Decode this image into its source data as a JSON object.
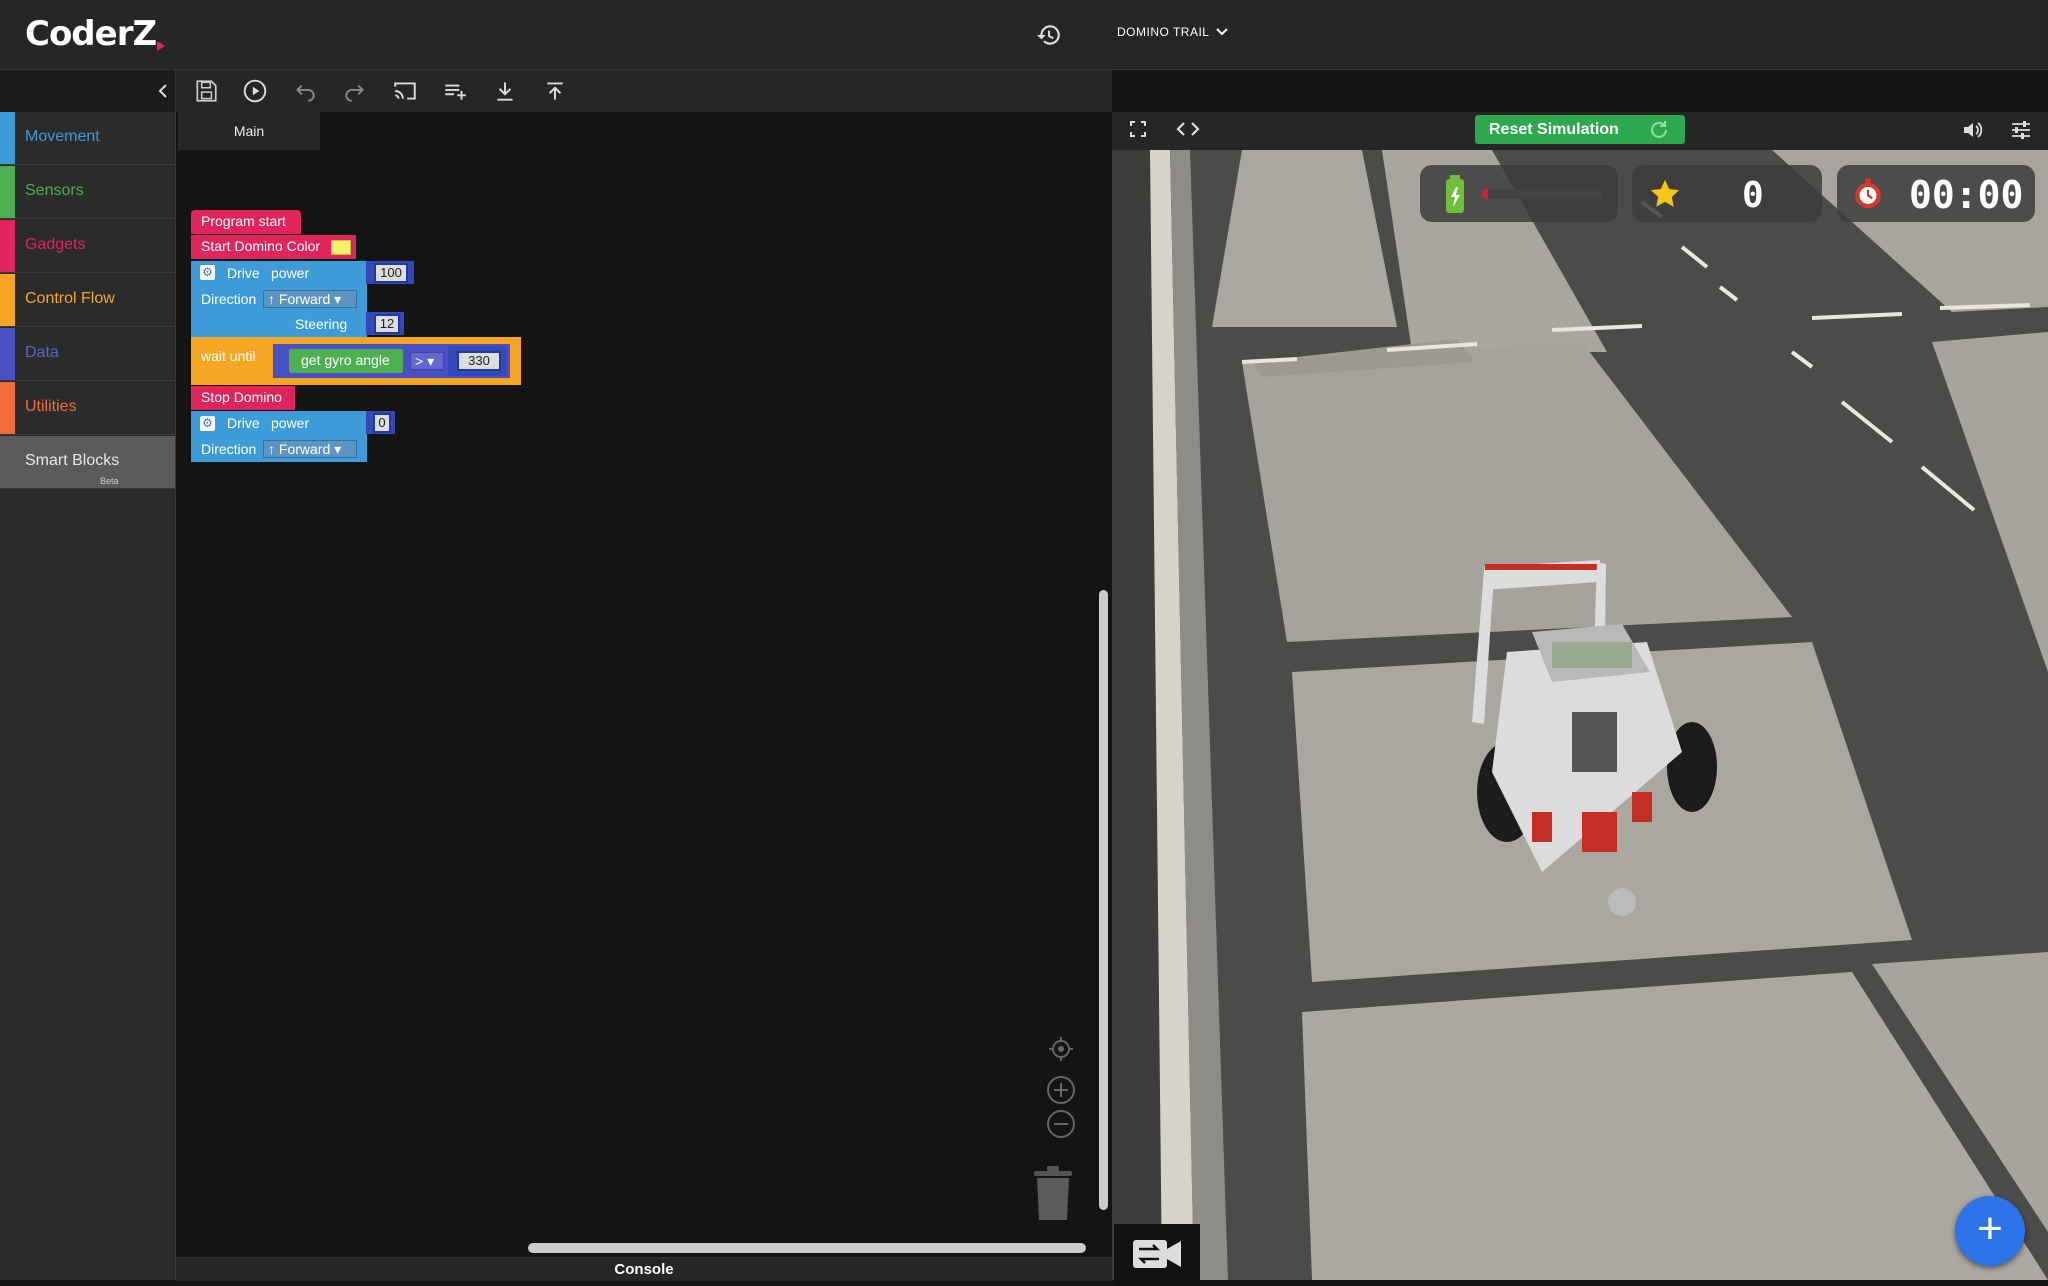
{
  "header": {
    "logo_main": "CoderZ",
    "mission_title": "DOMINO TRAIL",
    "icons": [
      "history-icon",
      "chevron-down-icon"
    ]
  },
  "toolbar": {
    "icons": [
      "chevron-left-icon",
      "save-icon",
      "play-icon",
      "undo-icon",
      "redo-icon",
      "cast-icon",
      "playlist-add-icon",
      "download-icon",
      "upload-icon"
    ]
  },
  "sidebar": {
    "items": [
      {
        "label": "Movement",
        "color": "#3d9bd7"
      },
      {
        "label": "Sensors",
        "color": "#4caf50"
      },
      {
        "label": "Gadgets",
        "color": "#e0245e"
      },
      {
        "label": "Control Flow",
        "color": "#f5a623"
      },
      {
        "label": "Data",
        "color": "#4a4fc4"
      },
      {
        "label": "Utilities",
        "color": "#f26b3a"
      },
      {
        "label": "Smart Blocks",
        "badge": "Beta"
      }
    ]
  },
  "workspace": {
    "tab_label": "Main",
    "blocks": {
      "program_start": "Program start",
      "start_domino_color": "Start Domino Color",
      "drive1": {
        "label": "Drive",
        "param": "power",
        "power": "100",
        "direction_label": "Direction",
        "direction_value": "Forward",
        "steering_label": "Steering",
        "steering_value": "12"
      },
      "wait": {
        "label": "wait until",
        "sensor": "get gyro angle",
        "operator": ">",
        "value": "330"
      },
      "stop_domino": "Stop Domino",
      "drive2": {
        "label": "Drive",
        "param": "power",
        "power": "0",
        "direction_label": "Direction",
        "direction_value": "Forward"
      }
    },
    "console_label": "Console",
    "icons": [
      "locate-icon",
      "zoom-in-icon",
      "zoom-out-icon",
      "trash-icon"
    ]
  },
  "simulation": {
    "reset_label": "Reset Simulation",
    "score": "0",
    "timer": "00:00",
    "icons": [
      "fullscreen-icon",
      "code-icon",
      "refresh-icon",
      "volume-icon",
      "settings-sliders-icon",
      "battery-icon",
      "star-icon",
      "stopwatch-icon",
      "camera-switch-icon",
      "plus-icon"
    ]
  },
  "colors": {
    "movement": "#3d9bd7",
    "gadgets": "#e0245e",
    "control_flow": "#f5a623",
    "data": "#4a4fc4",
    "sensors": "#4caf50",
    "reset_green": "#2ea84f",
    "fab_blue": "#2d74e8"
  }
}
